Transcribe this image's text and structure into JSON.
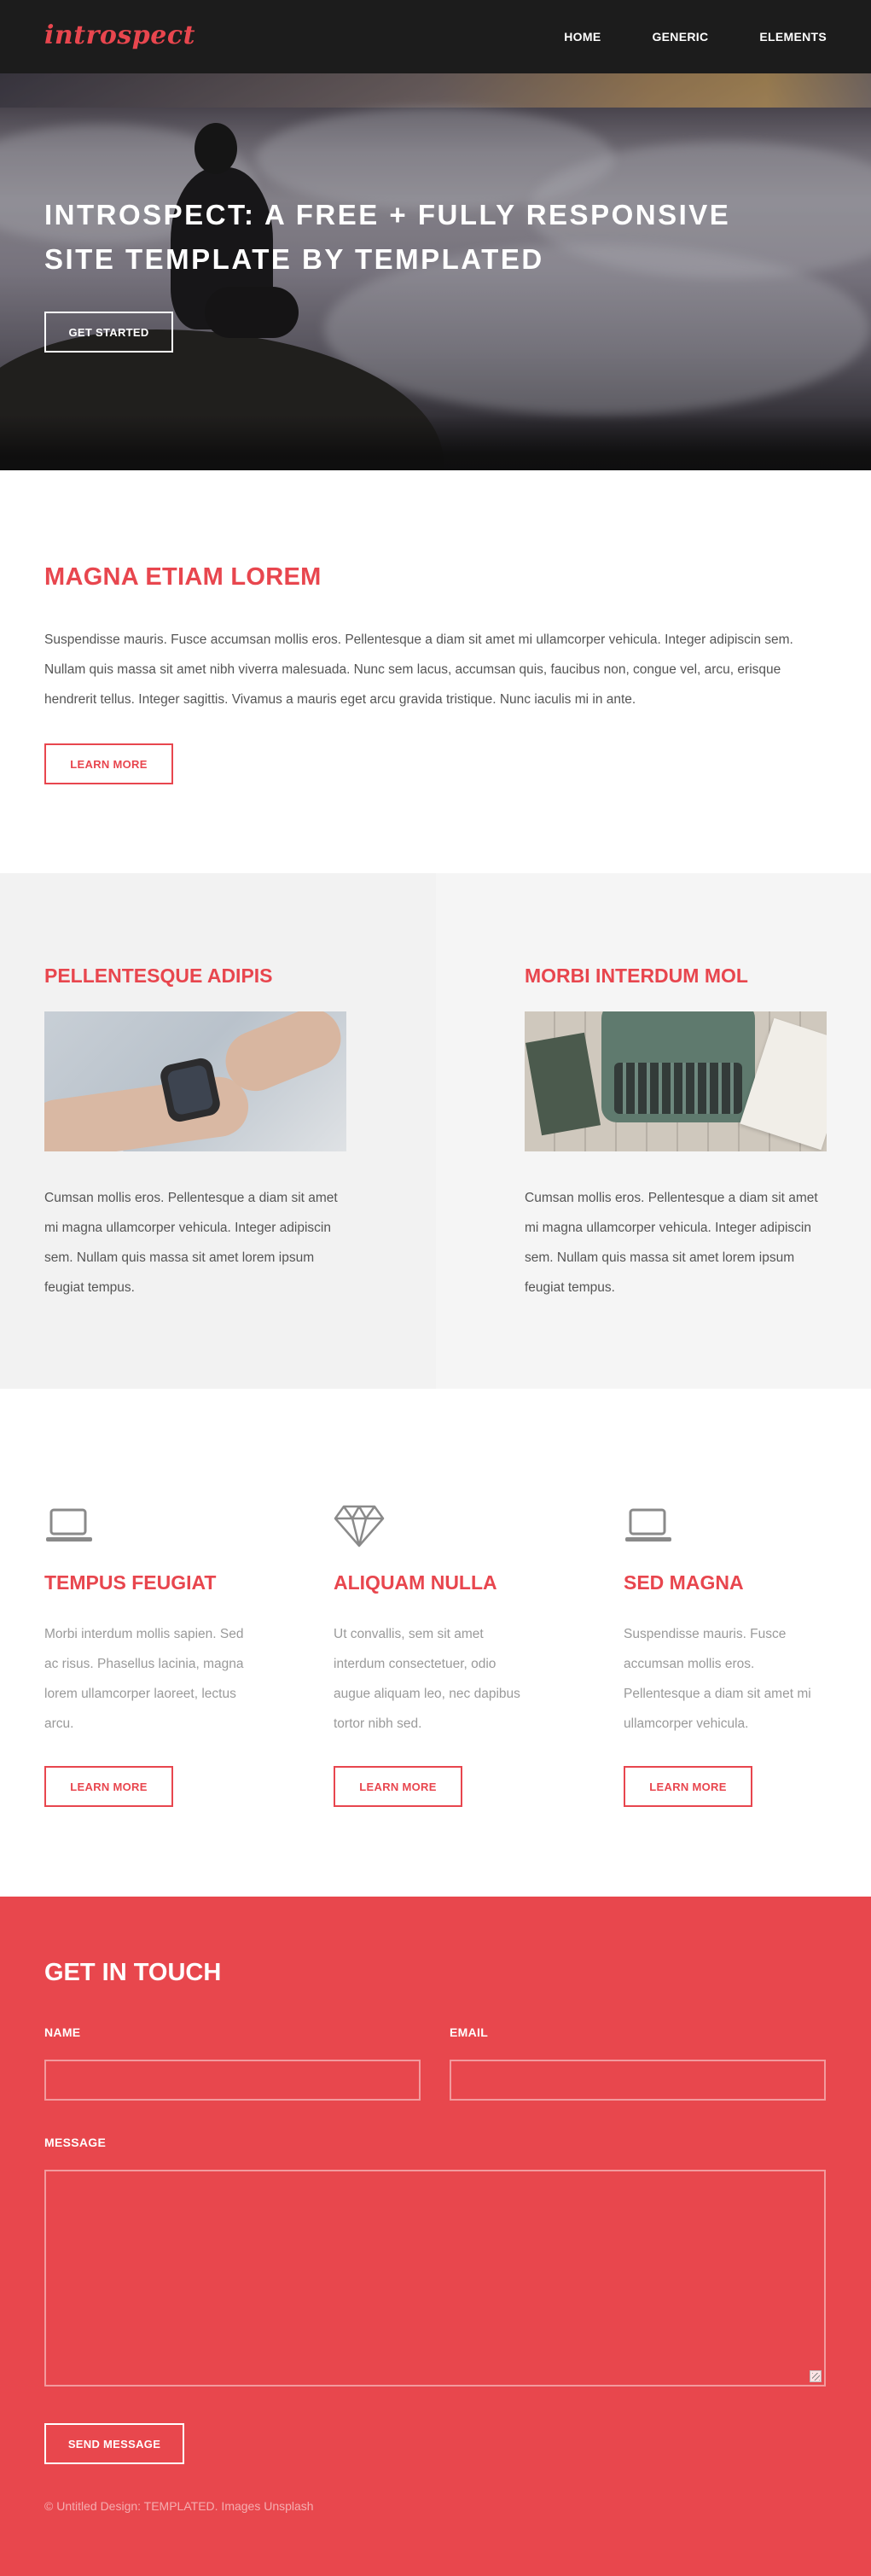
{
  "header": {
    "logo": "introspect",
    "nav": [
      "HOME",
      "GENERIC",
      "ELEMENTS"
    ]
  },
  "banner": {
    "title_strong": "INTROSPECT:",
    "title_rest": " A FREE + FULLY RESPONSIVE SITE TEMPLATE BY TEMPLATED",
    "button": "GET STARTED"
  },
  "one": {
    "title": "MAGNA ETIAM LOREM",
    "text": "Suspendisse mauris. Fusce accumsan mollis eros. Pellentesque a diam sit amet mi ullamcorper vehicula. Integer adipiscin sem. Nullam quis massa sit amet nibh viverra malesuada. Nunc sem lacus, accumsan quis, faucibus non, congue vel, arcu, erisque hendrerit tellus. Integer sagittis. Vivamus a mauris eget arcu gravida tristique. Nunc iaculis mi in ante.",
    "button": "LEARN MORE"
  },
  "two": {
    "left": {
      "title": "PELLENTESQUE ADIPIS",
      "text": "Cumsan mollis eros. Pellentesque a diam sit amet mi magna ullamcorper vehicula. Integer adipiscin sem. Nullam quis massa sit amet lorem ipsum feugiat tempus."
    },
    "right": {
      "title": "MORBI INTERDUM MOL",
      "text": "Cumsan mollis eros. Pellentesque a diam sit amet mi magna ullamcorper vehicula. Integer adipiscin sem. Nullam quis massa sit amet lorem ipsum feugiat tempus."
    }
  },
  "three": {
    "features": [
      {
        "icon": "laptop-icon",
        "title": "TEMPUS FEUGIAT",
        "text": "Morbi interdum mollis sapien. Sed ac risus. Phasellus lacinia, magna lorem ullamcorper laoreet, lectus arcu.",
        "button": "LEARN MORE"
      },
      {
        "icon": "diamond-icon",
        "title": "ALIQUAM NULLA",
        "text": "Ut convallis, sem sit amet interdum consectetuer, odio augue aliquam leo, nec dapibus tortor nibh sed.",
        "button": "LEARN MORE"
      },
      {
        "icon": "laptop-icon",
        "title": "SED MAGNA",
        "text": "Suspendisse mauris. Fusce accumsan mollis eros. Pellentesque a diam sit amet mi ullamcorper vehicula.",
        "button": "LEARN MORE"
      }
    ]
  },
  "contact": {
    "title": "GET IN TOUCH",
    "name_label": "NAME",
    "email_label": "EMAIL",
    "message_label": "MESSAGE",
    "name_value": "",
    "email_value": "",
    "message_value": "",
    "button": "SEND MESSAGE",
    "copyright": "© Untitled Design: TEMPLATED. Images Unsplash"
  },
  "colors": {
    "accent": "#e8464e",
    "header_bg": "#1c1c1c",
    "contact_bg": "#e8474d"
  }
}
